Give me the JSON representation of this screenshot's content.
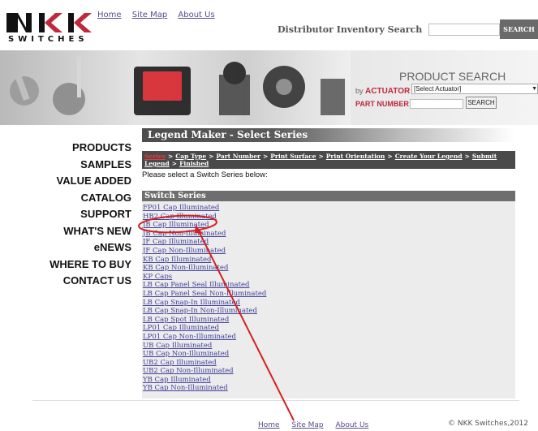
{
  "header": {
    "logo_text": "NKK",
    "logo_sub": "SWITCHES",
    "links": [
      "Home",
      "Site Map",
      "About Us"
    ],
    "inventory_label": "Distributor Inventory Search",
    "inventory_value": "",
    "search_button": "SEARCH"
  },
  "product_search": {
    "title": "PRODUCT SEARCH",
    "by_prefix": "by",
    "by_label": "ACTUATOR",
    "actuator_selected": "[Select Actuator]",
    "part_number_label": "PART NUMBER",
    "part_number_value": "",
    "search_button": "SEARCH"
  },
  "nav": [
    "PRODUCTS",
    "SAMPLES",
    "VALUE ADDED",
    "CATALOG",
    "SUPPORT",
    "WHAT'S NEW",
    "eNEWS",
    "WHERE TO BUY",
    "CONTACT US"
  ],
  "content": {
    "section_title": "Legend Maker - Select Series",
    "breadcrumbs": [
      "Series",
      "Cap Type",
      "Part Number",
      "Print Surface",
      "Print Orientation",
      "Create Your Legend",
      "Submit Legend",
      "Finished"
    ],
    "breadcrumb_separator": ">",
    "intro": "Please select a Switch Series below:",
    "series_title": "Switch Series",
    "series": [
      "FP01 Cap Illuminated",
      "HB2 Cap Illuminated",
      "JB Cap Illuminated",
      "JB Cap Non-Illuminated",
      "JF Cap Illuminated",
      "JF Cap Non-Illuminated",
      "KB Cap Illuminated",
      "KB Cap Non-Illuminated",
      "KP Caps",
      "LB Cap Panel Seal Illuminated",
      "LB Cap Panel Seal Non-Illuminated",
      "LB Cap Snap-In Illuminated",
      "LB Cap Snap-In Non-Illuminated",
      "LB Cap Spot Illuminated",
      "LP01 Cap Illuminated",
      "LP01 Cap Non-Illuminated",
      "UB Cap Illuminated",
      "UB Cap Non-Illuminated",
      "UB2 Cap Illuminated",
      "UB2 Cap Non-Illuminated",
      "YB Cap Illuminated",
      "YB Cap Non-Illuminated"
    ]
  },
  "footer": {
    "links": [
      "Home",
      "Site Map",
      "About Us"
    ],
    "copyright": "© NKK Switches,2012"
  },
  "colors": {
    "accent_red": "#c0283c",
    "link": "#40409a",
    "annotation": "#d42020"
  }
}
